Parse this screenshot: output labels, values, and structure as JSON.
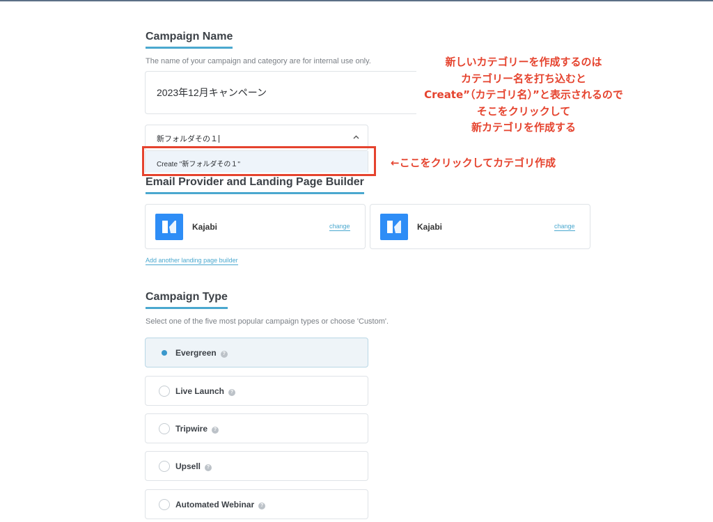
{
  "campaign_name": {
    "title": "Campaign Name",
    "helper": "The name of your campaign and category are for internal use only.",
    "name_value": "2023年12月キャンペーン",
    "category_value": "新フォルダその１",
    "create_option": "Create \"新フォルダその１\""
  },
  "provider": {
    "title": "Email Provider and Landing Page Builder",
    "cards": [
      {
        "name": "Kajabi",
        "change_label": "change"
      },
      {
        "name": "Kajabi",
        "change_label": "change"
      }
    ],
    "add_label": "Add another landing page builder"
  },
  "campaign_type": {
    "title": "Campaign Type",
    "helper": "Select one of the five most popular campaign types or choose 'Custom'.",
    "options": [
      {
        "label": "Evergreen",
        "selected": true
      },
      {
        "label": "Live Launch",
        "selected": false
      },
      {
        "label": "Tripwire",
        "selected": false
      },
      {
        "label": "Upsell",
        "selected": false
      },
      {
        "label": "Automated Webinar",
        "selected": false
      }
    ]
  },
  "annotations": {
    "main_lines": [
      "新しいカテゴリーを作成するのは",
      "カテゴリー名を打ち込むと",
      "Create”（カテゴリ名）”と表示されるので",
      "そこをクリックして",
      "新カテゴリを作成する"
    ],
    "arrow_note": "←ここをクリックしてカテゴリ作成"
  },
  "colors": {
    "accent": "#4aa8cf",
    "annotation_red": "#e5432e",
    "kajabi_blue": "#2e8df6"
  }
}
